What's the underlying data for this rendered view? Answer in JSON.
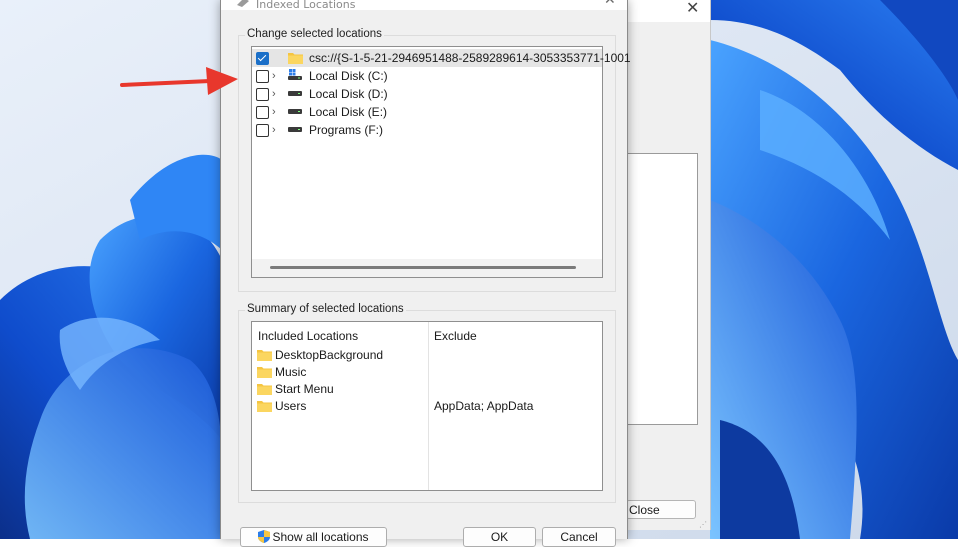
{
  "dialog": {
    "title": "Indexed Locations",
    "change_group_label": "Change selected locations",
    "tree": [
      {
        "label": "csc://{S-1-5-21-2946951488-2589289614-3053353771-1001",
        "checked": true,
        "icon": "folder-icon"
      },
      {
        "label": "Local Disk (C:)",
        "checked": false,
        "icon": "windows-drive-icon"
      },
      {
        "label": "Local Disk (D:)",
        "checked": false,
        "icon": "drive-icon"
      },
      {
        "label": "Local Disk (E:)",
        "checked": false,
        "icon": "drive-icon"
      },
      {
        "label": "Programs (F:)",
        "checked": false,
        "icon": "drive-icon"
      }
    ],
    "summary_group_label": "Summary of selected locations",
    "summary": {
      "headers": {
        "included": "Included Locations",
        "exclude": "Exclude"
      },
      "rows": [
        {
          "included": "DesktopBackground",
          "exclude": ""
        },
        {
          "included": "Music",
          "exclude": ""
        },
        {
          "included": "Start Menu",
          "exclude": ""
        },
        {
          "included": "Users",
          "exclude": "AppData; AppData"
        }
      ]
    },
    "buttons": {
      "show_all": "Show all locations",
      "ok": "OK",
      "cancel": "Cancel"
    }
  },
  "background_window": {
    "close_label": "Close"
  },
  "colors": {
    "accent": "#1a6fc8",
    "arrow": "#e8372c",
    "wallpaper_blue": "#1f6fe0"
  }
}
